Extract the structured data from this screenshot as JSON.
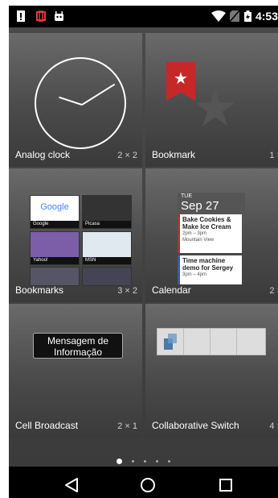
{
  "status_bar": {
    "time": "4:53",
    "left_icons": [
      "notification-icon",
      "usb-debug-icon",
      "android-icon"
    ],
    "right_icons": [
      "wifi-icon",
      "no-sim-icon",
      "battery-icon"
    ]
  },
  "widgets": [
    {
      "label": "Analog clock",
      "size": "2 × 2"
    },
    {
      "label": "Bookmark",
      "size": "1 ×"
    },
    {
      "label": "Bookmarks",
      "size": "3 × 2"
    },
    {
      "label": "Calendar",
      "size": "2 ×"
    },
    {
      "label": "Cell Broadcast",
      "size": "2 × 1"
    },
    {
      "label": "Collaborative Switch",
      "size": "4 ×"
    }
  ],
  "bookmarks_preview": [
    "Google",
    "Picasa",
    "Yahoo!",
    "MSN"
  ],
  "calendar_preview": {
    "dow": "TUE",
    "date": "Sep 27",
    "events": [
      {
        "title": "Bake Cookies & Make Ice Cream",
        "time": "2pm – 3pm",
        "place": "Mountain View"
      },
      {
        "title": "Time machine demo for Sergey",
        "time": "3pm – 4pm"
      }
    ]
  },
  "cell_broadcast_preview": "Mensagem de Informação",
  "pager": {
    "pages": 5,
    "current": 1
  },
  "nav": [
    "back-icon",
    "home-icon",
    "recents-icon"
  ],
  "colors": {
    "bookmark_ribbon": "#c62828",
    "background": "#3b3b3b"
  }
}
